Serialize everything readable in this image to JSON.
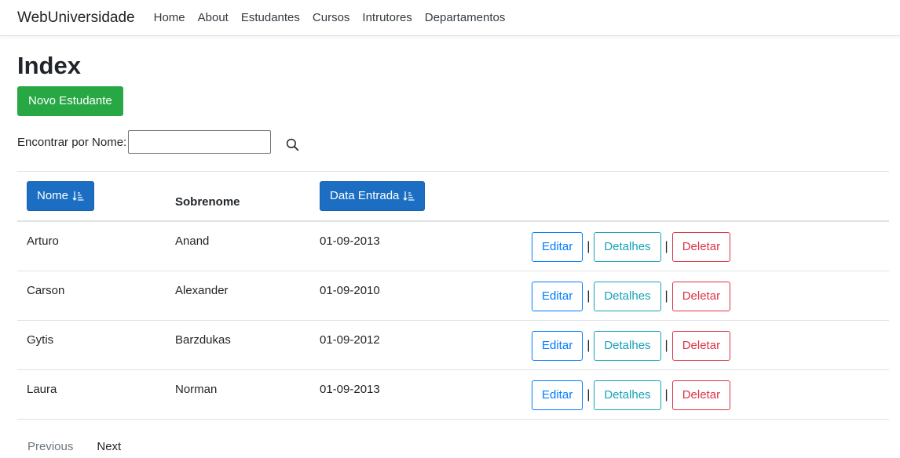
{
  "navbar": {
    "brand": "WebUniversidade",
    "links": [
      "Home",
      "About",
      "Estudantes",
      "Cursos",
      "Intrutores",
      "Departamentos"
    ]
  },
  "page": {
    "title": "Index",
    "new_button": "Novo Estudante"
  },
  "search": {
    "label": "Encontrar por Nome:",
    "value": "",
    "placeholder": ""
  },
  "table": {
    "headers": {
      "nome": "Nome",
      "sobrenome": "Sobrenome",
      "data_entrada": "Data Entrada"
    },
    "rows": [
      {
        "nome": "Arturo",
        "sobrenome": "Anand",
        "data": "01-09-2013"
      },
      {
        "nome": "Carson",
        "sobrenome": "Alexander",
        "data": "01-09-2010"
      },
      {
        "nome": "Gytis",
        "sobrenome": "Barzdukas",
        "data": "01-09-2012"
      },
      {
        "nome": "Laura",
        "sobrenome": "Norman",
        "data": "01-09-2013"
      }
    ],
    "actions": {
      "edit": "Editar",
      "details": "Detalhes",
      "delete": "Deletar",
      "separator": "|"
    }
  },
  "pager": {
    "previous": "Previous",
    "next": "Next"
  },
  "colors": {
    "primary": "#1b6ec2",
    "success": "#28a745",
    "info": "#17a2b8",
    "danger": "#dc3545",
    "link": "#007bff"
  },
  "icons": {
    "search": "search-icon",
    "sort": "sort-descending-icon"
  }
}
